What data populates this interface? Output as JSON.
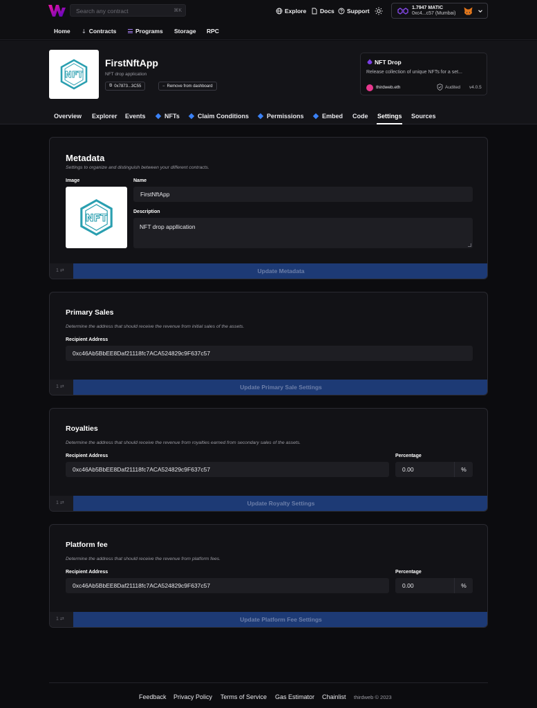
{
  "header": {
    "search_placeholder": "Search any contract",
    "search_shortcut": "⌘K",
    "links": [
      "Explore",
      "Docs",
      "Support"
    ],
    "wallet": {
      "balance": "1.7947 MATIC",
      "address": "0xc4...c57 (Mumbai)"
    },
    "nav": [
      "Home",
      "Contracts",
      "Programs",
      "Storage",
      "RPC"
    ]
  },
  "contract": {
    "name": "FirstNftApp",
    "description": "NFT drop application",
    "address": "0x7873...3C55",
    "remove_label": "Remove from dashboard",
    "card": {
      "title": "NFT Drop",
      "description": "Release collection of unique NFTs for a set...",
      "publisher": "thirdweb.eth",
      "audited": "Audited",
      "version": "v4.0.5"
    }
  },
  "tabs": [
    "Overview",
    "Explorer",
    "Events",
    "NFTs",
    "Claim Conditions",
    "Permissions",
    "Embed",
    "Code",
    "Settings",
    "Sources"
  ],
  "active_tab": "Settings",
  "metadata": {
    "title": "Metadata",
    "subtitle": "Settings to organize and distinguish between your different contracts.",
    "image_label": "Image",
    "name_label": "Name",
    "name_value": "FirstNftApp",
    "desc_label": "Description",
    "desc_value": "NFT drop appllication",
    "count": "1",
    "button": "Update Metadata"
  },
  "primary_sales": {
    "title": "Primary Sales",
    "subtitle": "Determine the address that should receive the revenue from initial sales of the assets.",
    "recipient_label": "Recipient Address",
    "recipient_value": "0xc46Ab5BbEE8Daf21118fc7ACA524829c9F637c57",
    "count": "1",
    "button": "Update Primary Sale Settings"
  },
  "royalties": {
    "title": "Royalties",
    "subtitle": "Determine the address that should receive the revenue from royalties earned from secondary sales of the assets.",
    "recipient_label": "Recipient Address",
    "recipient_value": "0xc46Ab5BbEE8Daf21118fc7ACA524829c9F637c57",
    "percentage_label": "Percentage",
    "percentage_value": "0.00",
    "percent_symbol": "%",
    "count": "1",
    "button": "Update Royalty Settings"
  },
  "platform_fee": {
    "title": "Platform fee",
    "subtitle": "Determine the address that should receive the revenue from platform fees.",
    "recipient_label": "Recipient Address",
    "recipient_value": "0xc46Ab5BbEE8Daf21118fc7ACA524829c9F637c57",
    "percentage_label": "Percentage",
    "percentage_value": "0.00",
    "percent_symbol": "%",
    "count": "1",
    "button": "Update Platform Fee Settings"
  },
  "footer": {
    "links": [
      "Feedback",
      "Privacy Policy",
      "Terms of Service",
      "Gas Estimator",
      "Chainlist"
    ],
    "copyright": "thirdweb © 2023"
  },
  "colors": {
    "accent": "#1d3a75",
    "tab_marker": "#3b82f6",
    "background": "#0c0c0f"
  }
}
